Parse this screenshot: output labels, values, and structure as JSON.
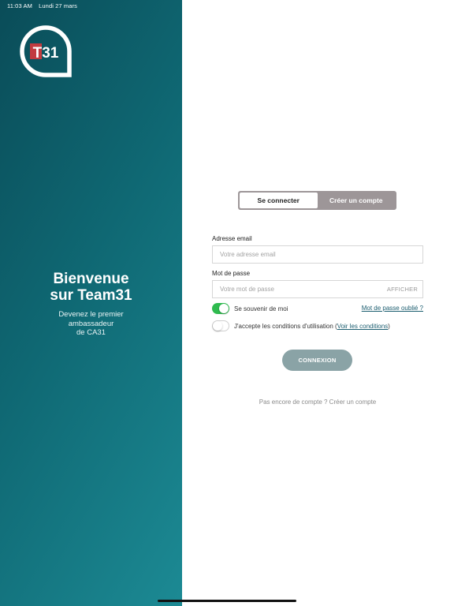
{
  "status_bar": {
    "time": "11:03 AM",
    "date": "Lundi 27 mars"
  },
  "brand": {
    "logo_text": "T31",
    "logo_color": "#ffffff"
  },
  "welcome": {
    "title_line1": "Bienvenue",
    "title_line2": "sur Team31",
    "sub_line1": "Devenez le premier",
    "sub_line2": "ambassadeur",
    "sub_line3": "de CA31"
  },
  "tabs": [
    {
      "label": "Se connecter",
      "active": true
    },
    {
      "label": "Créer un compte",
      "active": false
    }
  ],
  "form": {
    "email_label": "Adresse email",
    "email_placeholder": "Votre adresse email",
    "email_value": "",
    "password_label": "Mot de passe",
    "password_placeholder": "Votre mot de passe",
    "password_value": "",
    "show_label": "AFFICHER",
    "remember_label": "Se souvenir de moi",
    "remember_on": true,
    "forgot_label": "Mot de passe oublié ?",
    "terms_text": "J'accepte les conditions d'utilisation (",
    "terms_link": "Voir les conditions",
    "terms_close": ")",
    "terms_on": false,
    "submit_label": "CONNEXION"
  },
  "footer": {
    "text": "Pas encore de compte ? Créer un compte"
  },
  "colors": {
    "gradient_start": "#0a4c58",
    "gradient_end": "#1c8a94",
    "toggle_on": "#2fbb4f",
    "button": "#8aa3a6",
    "tab_bg": "#9d9698"
  }
}
